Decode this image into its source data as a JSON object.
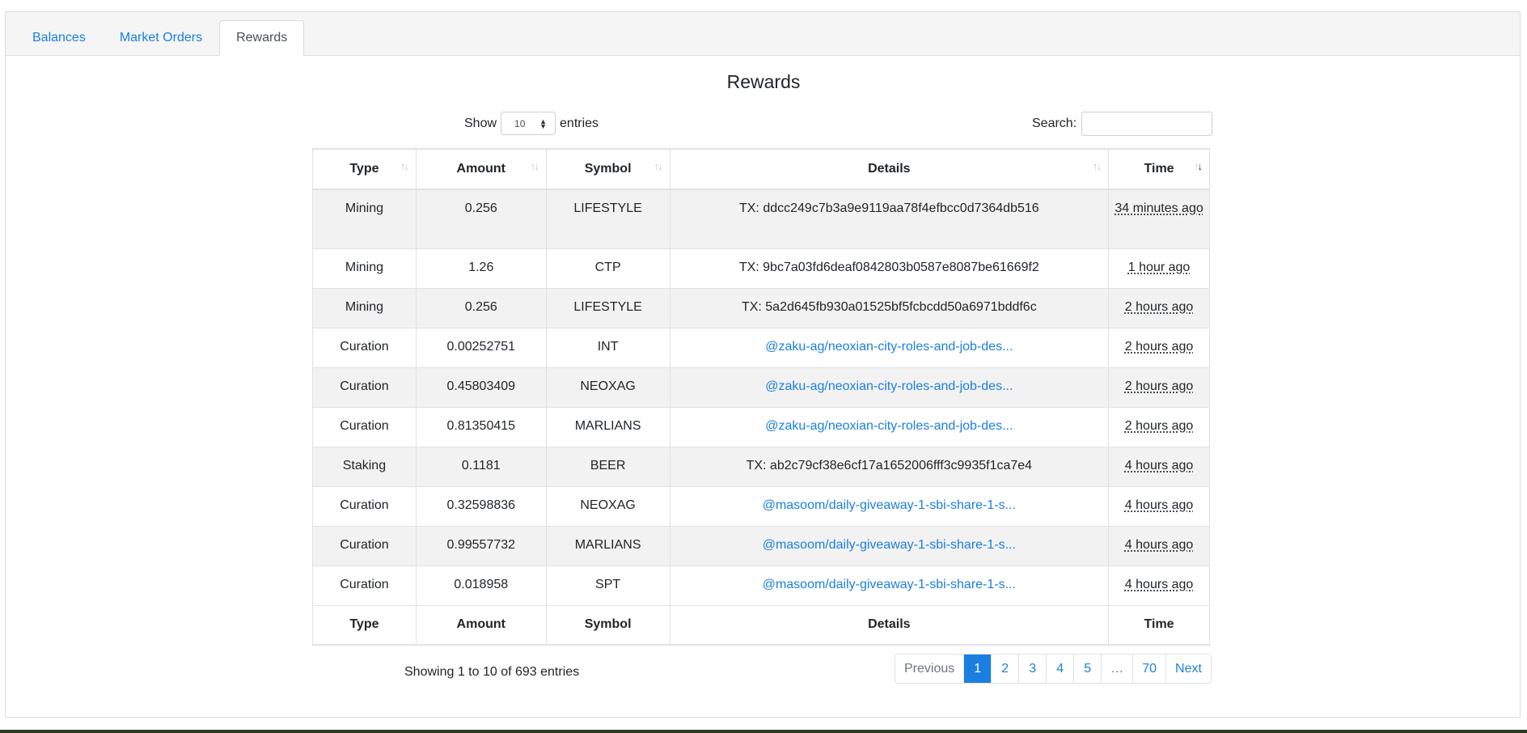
{
  "tabs": [
    {
      "label": "Balances",
      "active": false
    },
    {
      "label": "Market Orders",
      "active": false
    },
    {
      "label": "Rewards",
      "active": true
    }
  ],
  "title": "Rewards",
  "length": {
    "prefix": "Show",
    "value": "10",
    "suffix": "entries"
  },
  "search": {
    "label": "Search:",
    "value": ""
  },
  "columns": [
    "Type",
    "Amount",
    "Symbol",
    "Details",
    "Time"
  ],
  "rows": [
    {
      "type": "Mining",
      "amount": "0.256",
      "symbol": "LIFESTYLE",
      "details": "TX: ddcc249c7b3a9e9119aa78f4efbcc0d7364db516",
      "time": "34 minutes ago"
    },
    {
      "type": "Mining",
      "amount": "1.26",
      "symbol": "CTP",
      "details": "TX: 9bc7a03fd6deaf0842803b0587e8087be61669f2",
      "time": "1 hour ago"
    },
    {
      "type": "Mining",
      "amount": "0.256",
      "symbol": "LIFESTYLE",
      "details": "TX: 5a2d645fb930a01525bf5fcbcdd50a6971bddf6c",
      "time": "2 hours ago"
    },
    {
      "type": "Curation",
      "amount": "0.00252751",
      "symbol": "INT",
      "details": "@zaku-ag/neoxian-city-roles-and-job-des...",
      "time": "2 hours ago"
    },
    {
      "type": "Curation",
      "amount": "0.45803409",
      "symbol": "NEOXAG",
      "details": "@zaku-ag/neoxian-city-roles-and-job-des...",
      "time": "2 hours ago"
    },
    {
      "type": "Curation",
      "amount": "0.81350415",
      "symbol": "MARLIANS",
      "details": "@zaku-ag/neoxian-city-roles-and-job-des...",
      "time": "2 hours ago"
    },
    {
      "type": "Staking",
      "amount": "0.1181",
      "symbol": "BEER",
      "details": "TX: ab2c79cf38e6cf17a1652006fff3c9935f1ca7e4",
      "time": "4 hours ago"
    },
    {
      "type": "Curation",
      "amount": "0.32598836",
      "symbol": "NEOXAG",
      "details": "@masoom/daily-giveaway-1-sbi-share-1-s...",
      "time": "4 hours ago"
    },
    {
      "type": "Curation",
      "amount": "0.99557732",
      "symbol": "MARLIANS",
      "details": "@masoom/daily-giveaway-1-sbi-share-1-s...",
      "time": "4 hours ago"
    },
    {
      "type": "Curation",
      "amount": "0.018958",
      "symbol": "SPT",
      "details": "@masoom/daily-giveaway-1-sbi-share-1-s...",
      "time": "4 hours ago"
    }
  ],
  "info": "Showing 1 to 10 of 693 entries",
  "pagination": {
    "previous": "Previous",
    "pages": [
      "1",
      "2",
      "3",
      "4",
      "5",
      "…",
      "70"
    ],
    "active": "1",
    "next": "Next"
  },
  "colors": {
    "link": "#1a7fe0",
    "active_page": "#1a7fe0"
  }
}
